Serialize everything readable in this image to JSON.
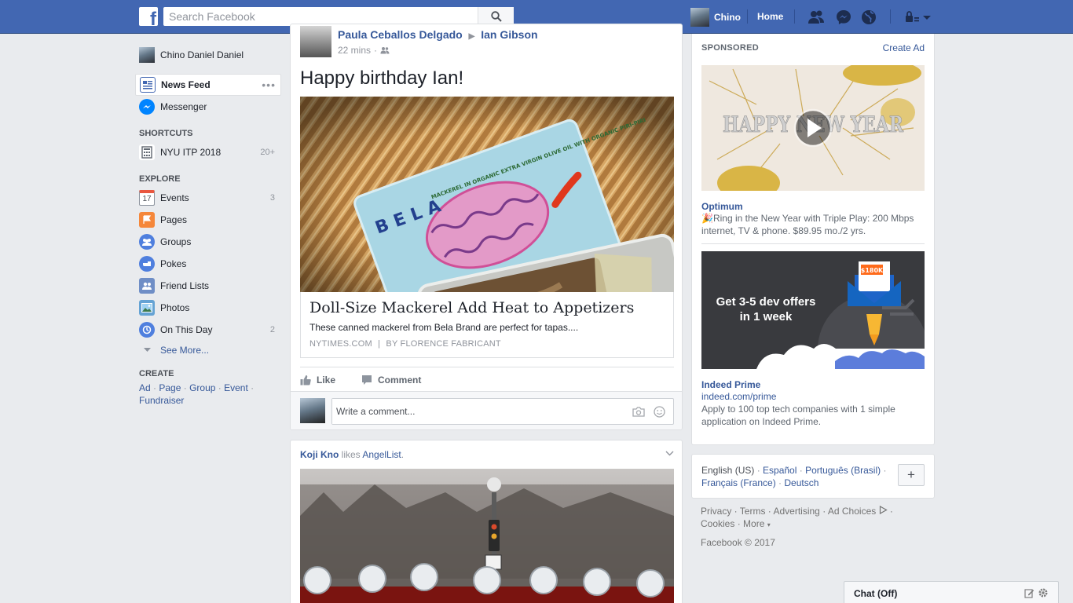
{
  "topbar": {
    "search_placeholder": "Search Facebook",
    "user_name": "Chino",
    "home_label": "Home",
    "logo_letter": "f"
  },
  "leftnav": {
    "profile_name": "Chino Daniel Daniel",
    "items": [
      {
        "label": "News Feed",
        "icon": "news-feed-icon"
      },
      {
        "label": "Messenger",
        "icon": "messenger-icon"
      }
    ],
    "shortcuts_header": "SHORTCUTS",
    "shortcuts": [
      {
        "label": "NYU ITP 2018",
        "count": "20+"
      }
    ],
    "explore_header": "EXPLORE",
    "explore": [
      {
        "label": "Events",
        "count": "3",
        "icon_text": "17"
      },
      {
        "label": "Pages",
        "count": ""
      },
      {
        "label": "Groups",
        "count": ""
      },
      {
        "label": "Pokes",
        "count": ""
      },
      {
        "label": "Friend Lists",
        "count": ""
      },
      {
        "label": "Photos",
        "count": ""
      },
      {
        "label": "On This Day",
        "count": "2"
      }
    ],
    "see_more": "See More...",
    "create_header": "CREATE",
    "create_links": [
      "Ad",
      "Page",
      "Group",
      "Event",
      "Fundraiser"
    ]
  },
  "post1": {
    "author": "Paula Ceballos Delgado",
    "arrow": "▶",
    "target": "Ian Gibson",
    "time": "22 mins",
    "message": "Happy birthday Ian!",
    "link_title": "Doll-Size Mackerel Add Heat to Appetizers",
    "link_desc": "These canned mackerel from Bela Brand are perfect for tapas....",
    "link_source": "NYTIMES.COM",
    "link_sep": "|",
    "link_byline": "BY FLORENCE FABRICANT",
    "image_brand": "BELA",
    "image_small": "MACKEREL IN ORGANIC EXTRA VIRGIN OLIVE OIL WITH ORGANIC PIRI-PIRI",
    "like_label": "Like",
    "comment_label": "Comment",
    "comment_placeholder": "Write a comment..."
  },
  "post2": {
    "actor": "Koji Kno",
    "verb": "likes",
    "page": "AngelList",
    "period": "."
  },
  "sidebar": {
    "sponsored_label": "SPONSORED",
    "create_ad_label": "Create Ad",
    "ads": [
      {
        "image_text": "HAPPY NEW YEAR",
        "title": "Optimum",
        "emoji": "🎉",
        "text": "Ring in the New Year with Triple Play: 200 Mbps internet, TV & phone. $89.95 mo./2 yrs."
      },
      {
        "image_headline": "Get 3-5 dev offers in 1 week",
        "image_badge": "$180K",
        "title": "Indeed Prime",
        "url": "indeed.com/prime",
        "text": "Apply to 100 top tech companies with 1 simple application on Indeed Prime."
      }
    ],
    "languages": [
      "English (US)",
      "Español",
      "Português (Brasil)",
      "Français (France)",
      "Deutsch"
    ],
    "lang_add_label": "+",
    "footer_links": [
      "Privacy",
      "Terms",
      "Advertising",
      "Ad Choices",
      "Cookies",
      "More"
    ],
    "copyright": "Facebook © 2017"
  },
  "chat": {
    "label": "Chat (Off)"
  },
  "colors": {
    "brand": "#4267b2",
    "link": "#365899",
    "bg": "#e9ebee"
  }
}
